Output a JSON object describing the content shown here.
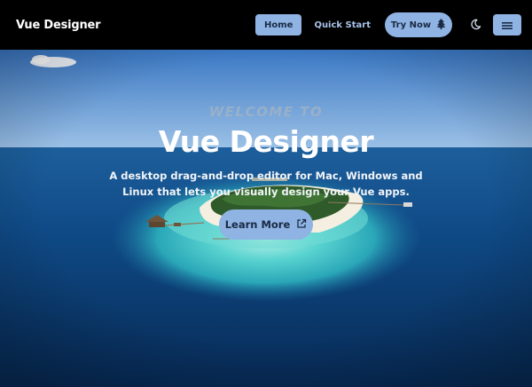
{
  "navbar": {
    "brand": "Vue Designer",
    "home_label": "Home",
    "quick_start_label": "Quick Start",
    "try_now_label": "Try Now",
    "try_now_icon": "tree-icon",
    "theme_icon": "moon-icon",
    "menu_icon": "hamburger-menu-icon"
  },
  "hero": {
    "welcome": "WELCOME TO",
    "title": "Vue Designer",
    "subtitle": "A desktop drag-and-drop editor for Mac, Windows and Linux that lets you visually design your Vue apps.",
    "learn_more_label": "Learn More",
    "learn_more_icon": "external-link-icon"
  },
  "colors": {
    "accent": "#8fb3e3",
    "navbar_bg": "#000000",
    "ocean": "#0b3d73",
    "lagoon": "#3fc6c6"
  }
}
